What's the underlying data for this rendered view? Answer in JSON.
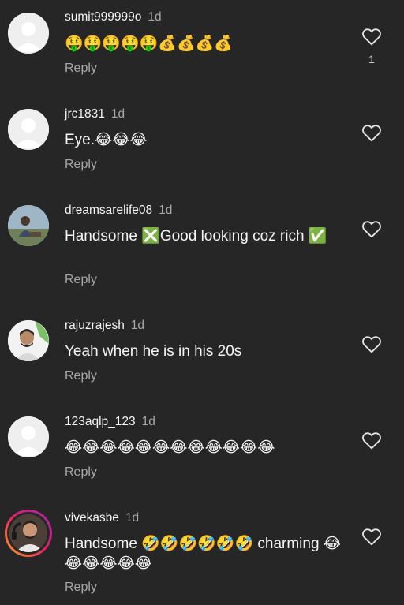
{
  "comments": [
    {
      "username": "sumit999999o",
      "time": "1d",
      "text": "🤑🤑🤑🤑🤑💰💰💰💰",
      "reply_label": "Reply",
      "like_count": "1"
    },
    {
      "username": "jrc1831",
      "time": "1d",
      "text": "Eye.😂😂😂",
      "reply_label": "Reply"
    },
    {
      "username": "dreamsarelife08",
      "time": "1d",
      "text": "Handsome ❎Good looking coz rich ✅",
      "reply_label": "Reply"
    },
    {
      "username": "rajuzrajesh",
      "time": "1d",
      "text": "Yeah when he is in his 20s",
      "reply_label": "Reply"
    },
    {
      "username": "123aqlp_123",
      "time": "1d",
      "text": "😂😂😂😂😂😂😂😂😂😂😂😂",
      "reply_label": "Reply"
    },
    {
      "username": "vivekasbe",
      "time": "1d",
      "text": "Handsome 🤣🤣🤣🤣🤣🤣 charming 😂😂😂😂😂😂",
      "reply_label": "Reply"
    }
  ],
  "icons": {
    "like": "heart-outline-icon",
    "default_avatar": "default-avatar-icon"
  },
  "colors": {
    "background": "#262626",
    "primary_text": "#f5f5f5",
    "secondary_text": "#a8a8a8"
  }
}
